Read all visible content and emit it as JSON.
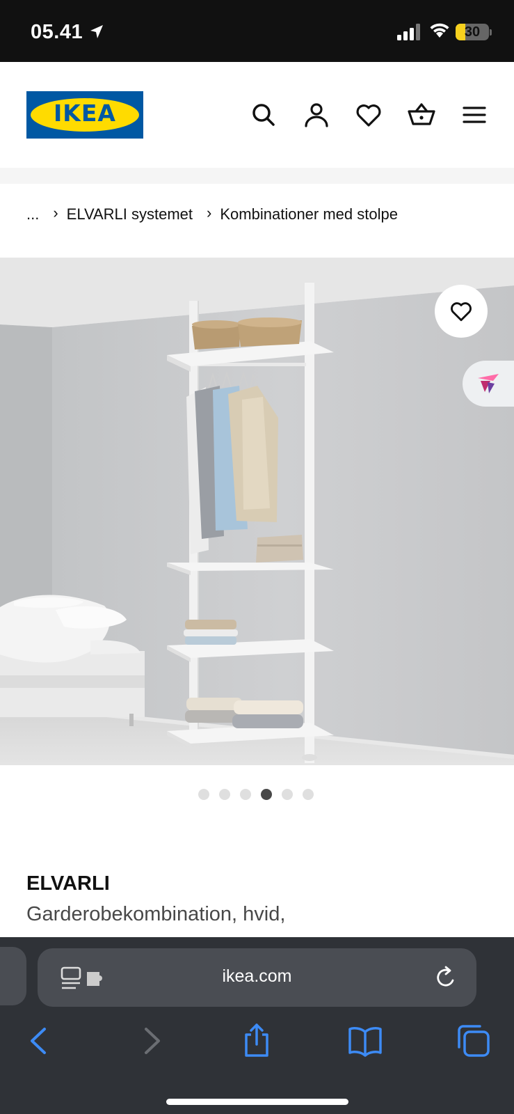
{
  "status_bar": {
    "time": "05.41",
    "battery_level": "30",
    "battery_fraction": 0.3
  },
  "header": {
    "logo_text": "IKEA",
    "icons": [
      "search-icon",
      "account-icon",
      "heart-icon",
      "basket-icon",
      "menu-icon"
    ]
  },
  "breadcrumb": {
    "items": [
      "...",
      "ELVARLI systemet",
      "Kombinationer med stolpe"
    ]
  },
  "gallery": {
    "slide_count": 6,
    "active_slide": 4
  },
  "product": {
    "name": "ELVARLI",
    "description": "Garderobekombination, hvid,"
  },
  "browser": {
    "url": "ikea.com",
    "accent_color": "#3d8bf5"
  },
  "colors": {
    "ikea_blue": "#0058a3",
    "ikea_yellow": "#ffdb00"
  }
}
